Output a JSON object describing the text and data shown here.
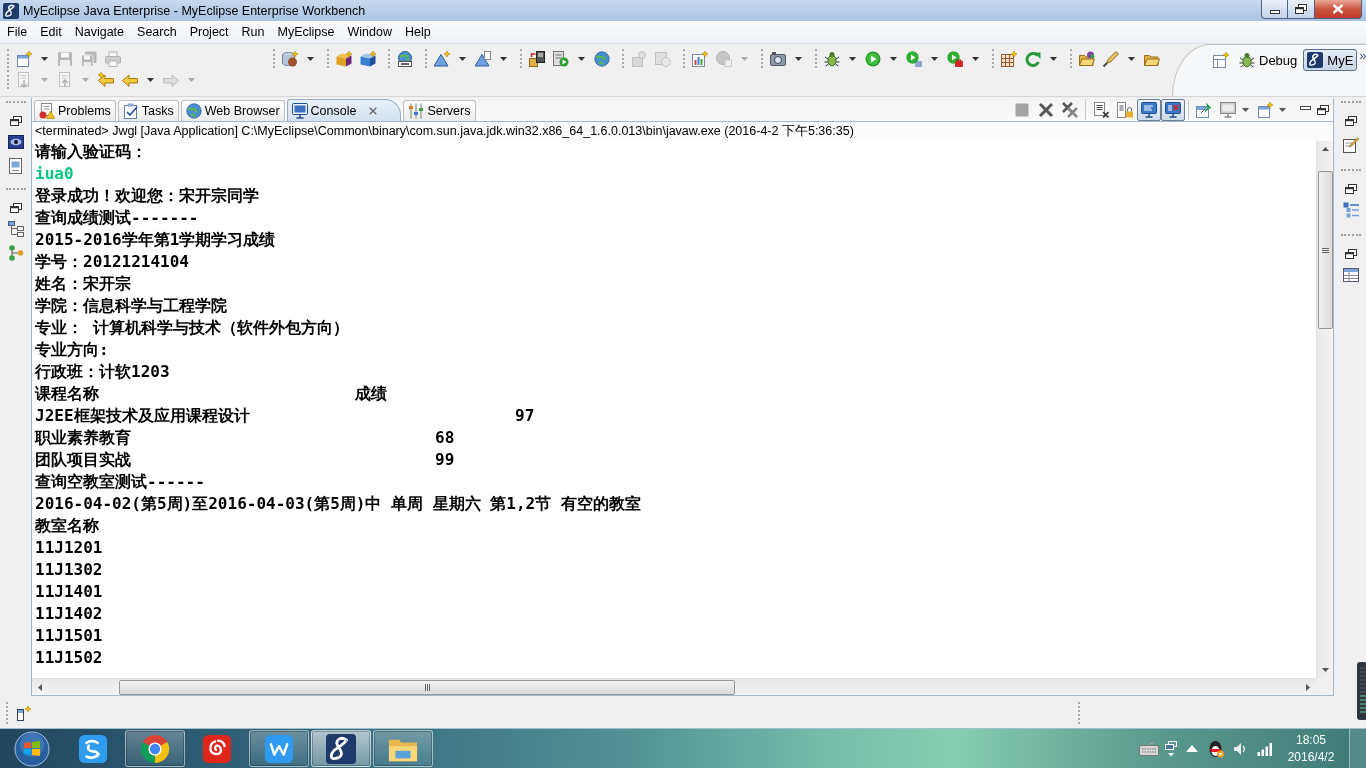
{
  "window": {
    "title": "MyEclipse Java Enterprise - MyEclipse Enterprise Workbench"
  },
  "menu": [
    "File",
    "Edit",
    "Navigate",
    "Search",
    "Project",
    "Run",
    "MyEclipse",
    "Window",
    "Help"
  ],
  "toolbar": {
    "rows": [
      [
        [
          {
            "kind": "new",
            "menu": true,
            "disabled": false
          },
          {
            "kind": "save",
            "menu": false,
            "disabled": true
          },
          {
            "kind": "saveall",
            "menu": false,
            "disabled": true
          },
          {
            "kind": "print",
            "menu": false,
            "disabled": true
          }
        ],
        [
          {
            "kind": "service",
            "menu": true,
            "disabled": false
          }
        ],
        [
          {
            "kind": "ejb",
            "menu": false,
            "disabled": false
          },
          {
            "kind": "bean",
            "menu": false,
            "disabled": false
          }
        ],
        [
          {
            "kind": "browser",
            "menu": false,
            "disabled": false
          }
        ],
        [
          {
            "kind": "uml",
            "menu": true,
            "disabled": false
          },
          {
            "kind": "umldoc",
            "menu": true,
            "disabled": false
          }
        ],
        [
          {
            "kind": "deploy",
            "menu": false,
            "disabled": false
          },
          {
            "kind": "server",
            "menu": true,
            "disabled": false
          },
          {
            "kind": "globe",
            "menu": false,
            "disabled": false
          }
        ],
        [
          {
            "kind": "dbimport",
            "menu": false,
            "disabled": true
          },
          {
            "kind": "dbsync",
            "menu": false,
            "disabled": true
          }
        ],
        [
          {
            "kind": "report",
            "menu": false,
            "disabled": false
          },
          {
            "kind": "webtest",
            "menu": true,
            "disabled": true
          }
        ],
        [
          {
            "kind": "camera",
            "menu": true,
            "disabled": false
          }
        ],
        [
          {
            "kind": "debug",
            "menu": true,
            "disabled": false
          },
          {
            "kind": "run",
            "menu": true,
            "disabled": false
          },
          {
            "kind": "history",
            "menu": true,
            "disabled": false
          },
          {
            "kind": "tools",
            "menu": true,
            "disabled": false
          }
        ],
        [
          {
            "kind": "grid",
            "menu": false,
            "disabled": false
          },
          {
            "kind": "refresh",
            "menu": true,
            "disabled": false
          }
        ],
        [
          {
            "kind": "openfolder",
            "menu": false,
            "disabled": false
          },
          {
            "kind": "pen",
            "menu": true,
            "disabled": false
          },
          {
            "kind": "folder",
            "menu": false,
            "disabled": false
          }
        ]
      ],
      [
        [
          {
            "kind": "down",
            "menu": true,
            "disabled": true
          },
          {
            "kind": "up",
            "menu": true,
            "disabled": true
          },
          {
            "kind": "lastedit",
            "menu": false,
            "disabled": false
          },
          {
            "kind": "back",
            "menu": true,
            "disabled": false
          },
          {
            "kind": "forward",
            "menu": true,
            "disabled": true
          }
        ]
      ]
    ]
  },
  "perspectives": {
    "items": [
      {
        "kind": "debug",
        "label": "Debug",
        "selected": false
      },
      {
        "kind": "myeclipse",
        "label": "MyE",
        "selected": true
      }
    ],
    "overflow": "»"
  },
  "views": {
    "tabs": [
      {
        "kind": "problems",
        "label": "Problems",
        "selected": false
      },
      {
        "kind": "tasks",
        "label": "Tasks",
        "selected": false
      },
      {
        "kind": "browser",
        "label": "Web Browser",
        "selected": false
      },
      {
        "kind": "console",
        "label": "Console",
        "selected": true
      },
      {
        "kind": "servers",
        "label": "Servers",
        "selected": false
      }
    ],
    "toolbar": [
      [
        {
          "kind": "terminate",
          "disabled": true,
          "on": false,
          "menu": false
        },
        {
          "kind": "remove",
          "disabled": false,
          "on": false,
          "menu": false
        },
        {
          "kind": "removeall",
          "disabled": false,
          "on": false,
          "menu": false
        }
      ],
      [
        {
          "kind": "clear",
          "disabled": false,
          "on": false,
          "menu": false
        },
        {
          "kind": "scrolllock",
          "disabled": false,
          "on": false,
          "menu": false
        },
        {
          "kind": "stdout",
          "disabled": false,
          "on": true,
          "menu": false
        },
        {
          "kind": "stderr",
          "disabled": false,
          "on": true,
          "menu": false
        }
      ],
      [
        {
          "kind": "pin",
          "disabled": false,
          "on": false,
          "menu": false
        },
        {
          "kind": "display",
          "disabled": false,
          "on": false,
          "menu": true
        },
        {
          "kind": "open",
          "disabled": false,
          "on": false,
          "menu": true
        }
      ]
    ]
  },
  "console": {
    "description": "<terminated> Jwgl [Java Application] C:\\MyEclipse\\Common\\binary\\com.sun.java.jdk.win32.x86_64_1.6.0.013\\bin\\javaw.exe (2016-4-2 下午5:36:35)",
    "lines": [
      {
        "kind": "output",
        "text": "请输入验证码："
      },
      {
        "kind": "input",
        "text": "iua0"
      },
      {
        "kind": "output",
        "text": "登录成功！欢迎您：宋开宗同学"
      },
      {
        "kind": "output",
        "text": "查询成绩测试-------"
      },
      {
        "kind": "output",
        "text": "2015-2016学年第1学期学习成绩"
      },
      {
        "kind": "output",
        "text": "学号：20121214104"
      },
      {
        "kind": "output",
        "text": "姓名：宋开宗"
      },
      {
        "kind": "output",
        "text": "学院：信息科学与工程学院"
      },
      {
        "kind": "output",
        "text": "专业： 计算机科学与技术（软件外包方向）"
      },
      {
        "kind": "output",
        "text": "专业方向:"
      },
      {
        "kind": "output",
        "text": "行政班：计软1203"
      },
      {
        "kind": "heading",
        "cells": [
          "课程名称",
          "成绩"
        ]
      },
      {
        "kind": "row",
        "cells": [
          "J2EE框架技术及应用课程设计",
          "97"
        ]
      },
      {
        "kind": "row",
        "cells": [
          "职业素养教育",
          "68"
        ]
      },
      {
        "kind": "row",
        "cells": [
          "团队项目实战",
          "99"
        ]
      },
      {
        "kind": "output",
        "text": "查询空教室测试------"
      },
      {
        "kind": "output",
        "text": "2016-04-02(第5周)至2016-04-03(第5周)中 单周 星期六 第1,2节 有空的教室"
      },
      {
        "kind": "output",
        "text": "教室名称"
      },
      {
        "kind": "output",
        "text": "11J1201"
      },
      {
        "kind": "output",
        "text": "11J1302"
      },
      {
        "kind": "output",
        "text": "11J1401"
      },
      {
        "kind": "output",
        "text": "11J1402"
      },
      {
        "kind": "output",
        "text": "11J1501"
      },
      {
        "kind": "output",
        "text": "11J1502"
      }
    ]
  },
  "taskbar": {
    "apps": [
      {
        "kind": "pinyin",
        "running": false,
        "selected": false
      },
      {
        "kind": "chrome",
        "running": true,
        "selected": false
      },
      {
        "kind": "music",
        "running": false,
        "selected": false
      },
      {
        "kind": "wps",
        "running": true,
        "selected": false
      },
      {
        "kind": "myeclipse",
        "running": true,
        "selected": true
      },
      {
        "kind": "explorer",
        "running": true,
        "selected": false
      }
    ],
    "clock": {
      "time": "18:05",
      "date": "2016/4/2"
    }
  }
}
